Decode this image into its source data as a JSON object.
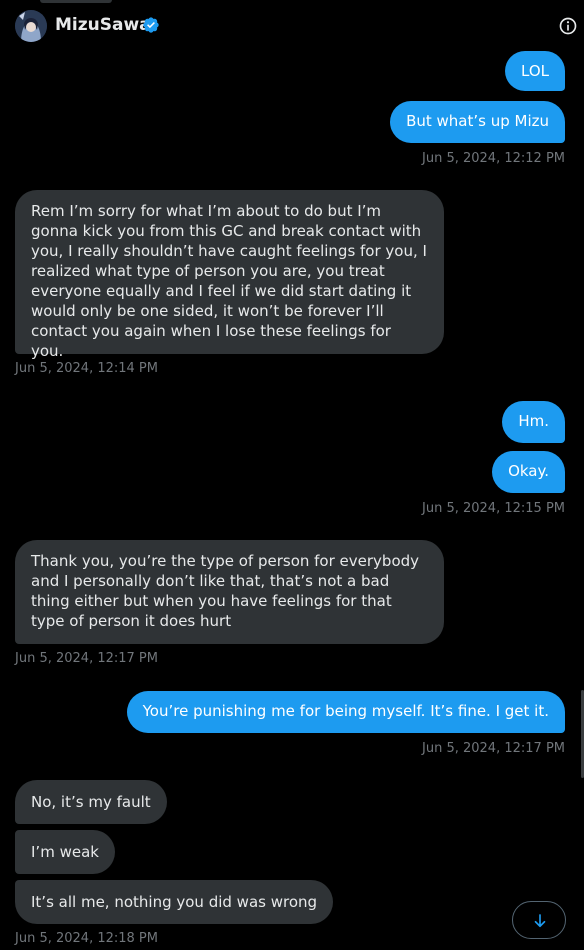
{
  "header": {
    "title": "MizuSawa",
    "verified_color": "#1d9bf0"
  },
  "messages": [
    {
      "side": "sent",
      "text": "LOL"
    },
    {
      "side": "sent",
      "text": "But what’s up Mizu"
    },
    {
      "side": "sent",
      "timestamp": "Jun 5, 2024, 12:12 PM"
    },
    {
      "side": "recv",
      "text": "Rem I’m sorry for what I’m about to do but I’m gonna kick you from this GC and break contact with you, I really shouldn’t have caught feelings for you, I realized what type of person you are, you treat everyone equally and I feel if we did start dating it would only be one sided, it won’t be forever I’ll contact you again when I lose these feelings for you."
    },
    {
      "side": "recv",
      "timestamp": "Jun 5, 2024, 12:14 PM"
    },
    {
      "side": "sent",
      "text": "Hm."
    },
    {
      "side": "sent",
      "text": "Okay."
    },
    {
      "side": "sent",
      "timestamp": "Jun 5, 2024, 12:15 PM"
    },
    {
      "side": "recv",
      "text": "Thank you, you’re the type of person for everybody and I personally don’t like that, that’s not a bad thing either but when you have feelings for that type of person it does hurt"
    },
    {
      "side": "recv",
      "timestamp": "Jun 5, 2024, 12:17 PM"
    },
    {
      "side": "sent",
      "text": "You’re punishing me for being myself. It’s fine. I get it."
    },
    {
      "side": "sent",
      "timestamp": "Jun 5, 2024, 12:17 PM"
    },
    {
      "side": "recv",
      "text": "No, it’s my fault"
    },
    {
      "side": "recv",
      "text": "I’m weak"
    },
    {
      "side": "recv",
      "text": "It’s all me, nothing you did was wrong"
    },
    {
      "side": "recv",
      "timestamp": "Jun 5, 2024, 12:18 PM"
    }
  ],
  "icons": {
    "info": "info-icon",
    "verified": "verified-badge-icon",
    "scroll_down": "arrow-down-icon"
  },
  "colors": {
    "sent_bubble": "#1d9bf0",
    "recv_bubble": "#2f3336",
    "background": "#000000",
    "timestamp": "#71767b"
  }
}
